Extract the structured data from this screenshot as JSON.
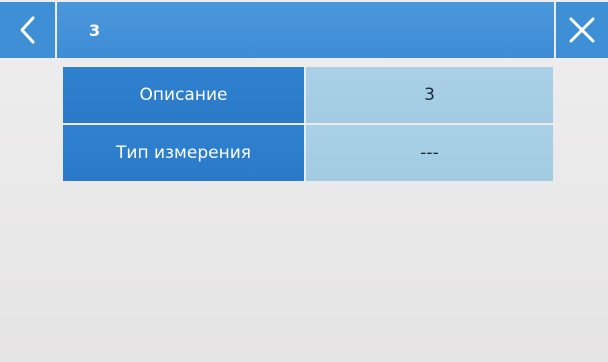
{
  "header": {
    "title": "3",
    "back_icon": "chevron-left-icon",
    "close_icon": "close-icon"
  },
  "properties": [
    {
      "label": "Описание",
      "value": "3"
    },
    {
      "label": "Тип измерения",
      "value": "---"
    }
  ],
  "colors": {
    "header_blue": "#3f8fd6",
    "label_blue": "#2a7ac8",
    "value_light_blue": "#a5cde4",
    "background": "#ebeaea"
  }
}
